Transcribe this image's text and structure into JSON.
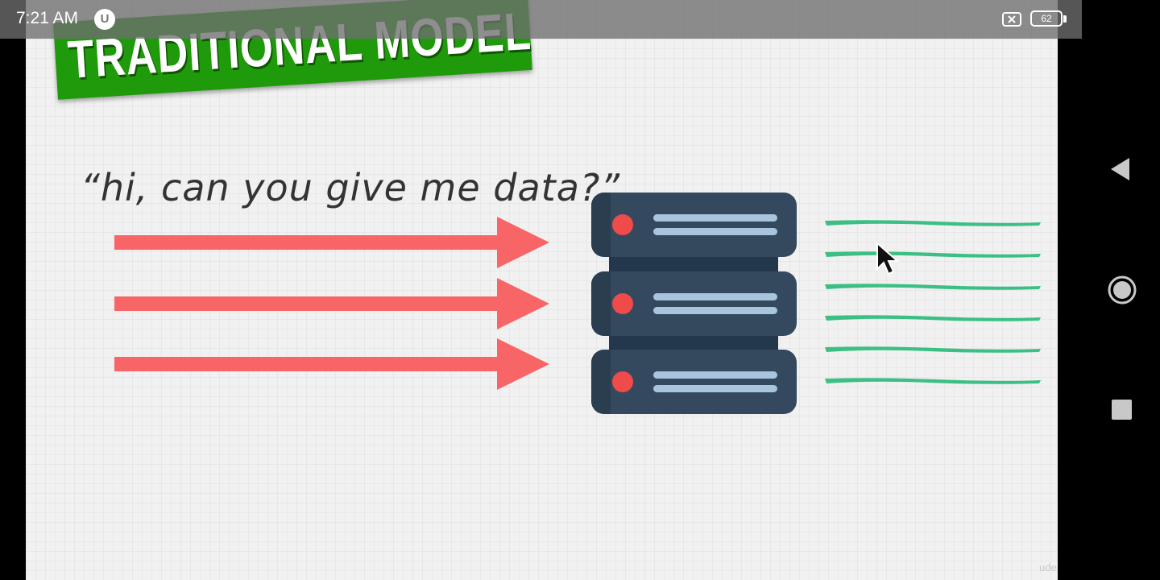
{
  "status_bar": {
    "time": "7:21 AM",
    "app_icon_glyph": "U",
    "app_icon": "udemy-icon",
    "sim_icon": "no-sim-icon",
    "battery_level": "62"
  },
  "slide": {
    "title": "TRADITIONAL MODEL",
    "quote": "“hi, can you give me data?”",
    "watermark": "udemy",
    "arrows_count": 3,
    "server_units": 3,
    "data_lines": 6,
    "colors": {
      "title_banner": "#1e9a0a",
      "arrow": "#f76566",
      "server": "#34495e",
      "server_shade": "#2b3e50",
      "server_led": "#ef4b4b",
      "server_lines": "#a8c5dd",
      "data_lines": "#3cbf84",
      "background": "#f1f1f1"
    }
  },
  "nav_bar": {
    "back": "back-triangle-icon",
    "home": "home-circle-icon",
    "recents": "recents-square-icon"
  }
}
